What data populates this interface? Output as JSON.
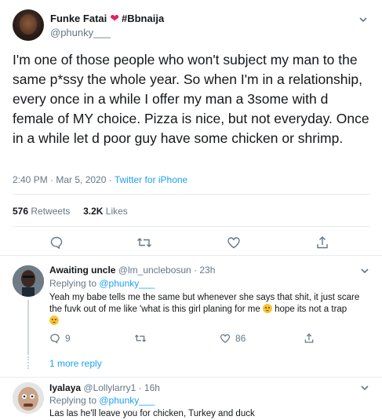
{
  "tweet": {
    "display_name": "Funke Fatai",
    "hashtag": "#Bbnaija",
    "handle": "@phunky___",
    "text": "I'm one of those people who won't subject my man to the same p*ssy the whole year. So when I'm in a relationship, every once in a while I offer my man a 3some with d female of MY choice. Pizza is nice, but not everyday. Once in a while let d poor guy have some chicken or shrimp.",
    "time": "2:40 PM · Mar 5, 2020 · ",
    "source": "Twitter for iPhone",
    "retweets_count": "576",
    "retweets_label": "Retweets",
    "likes_count": "3.2K",
    "likes_label": "Likes"
  },
  "replies": [
    {
      "display_name": "Awaiting uncle",
      "handle": "@lm_unclebosun · 23h",
      "replying_prefix": "Replying to ",
      "replying_to": "@phunky___",
      "text_1": "Yeah my babe tells me the same but whenever she says that shit, it just scare the fuvk out of me like 'what is this girl planing for me ",
      "text_2": " hope its not a trap",
      "reply_count": "9",
      "like_count": "86"
    },
    {
      "display_name": "Iyalaya",
      "handle": "@Lollylarry1 · 16h",
      "replying_prefix": "Replying to ",
      "replying_to": "@phunky___",
      "text": "Las las he'll leave you for chicken, Turkey and duck"
    }
  ],
  "more_replies_label": "1 more reply",
  "colors": {
    "accent": "#1da1f2",
    "secondary": "#657786",
    "like": "#e0245e"
  }
}
